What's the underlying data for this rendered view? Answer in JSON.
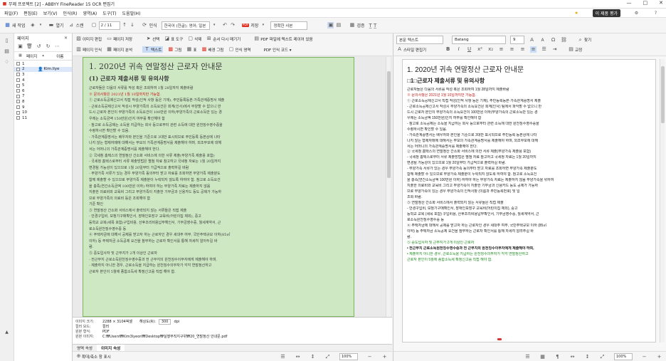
{
  "window": {
    "title": "무제 프로젝트 [2] - ABBYY FineReader 15 OCR 편집기",
    "min": "—",
    "max": "□",
    "close": "✕"
  },
  "menu": {
    "items": [
      "파일(F)",
      "편집(E)",
      "보기(V)",
      "인식(R)",
      "영역(A)",
      "도구(T)",
      "도움말(H)"
    ],
    "upgrade": "이 제품 평가"
  },
  "toolbar": {
    "new_task": "새 작업",
    "open": "열기",
    "scan": "스캔",
    "page_current": "2",
    "page_total": "/ 11",
    "recognize": "인식",
    "language": "한국어 (한글); 영어; 일본",
    "save": "저장",
    "pdf": "PDF",
    "save_format": "정확한 사본",
    "check": "검증",
    "ocr_icons": "T̲ T̲"
  },
  "pages_panel": {
    "title": "페이지",
    "col_page": "페이지",
    "col_name": "이름",
    "rows": [
      "1",
      "2",
      "3",
      "4",
      "5",
      "6",
      "7",
      "8",
      "9",
      "10",
      "11"
    ],
    "row2_name": "Kim.llye"
  },
  "image_panel": {
    "row1": [
      "이미지 편집",
      "페이지 저장",
      "선택",
      "표 도구",
      "삭제",
      "순서 다시 매기기",
      "PDF 파일에 텍스트 레이어 있음"
    ],
    "row2": [
      "페이지 인식",
      "페이지 분석",
      "텍스트",
      "그림",
      "표",
      "배경 그림",
      "인식 영역",
      "PDF 인식 코드 ▾"
    ],
    "scan_title": "1. 2020년 귀속 연말정산 근로자 안내문",
    "scan_subtitle": "(1) 근로자 제출서류 및 유의사항",
    "scan_lines": [
      "근로자들은 다음의 서류를 작성 혹은 조회하여 1월 28일까지 제출바람",
      "※ 문의사항은 2021년 1월 10일까지만 가능함.",
      "① 근로소득공제신고서 직접 작성(인적 사항 등은 기재), 주민등록등본·가족관계증명서 제출",
      "  - 근로소득공제신고서 작성시 부양가족의 소득요건은 회계(인사)에서 부양할 수 없으니 반",
      "  드시 근로자 본인이 부양가족의 소득요건이 100만원 이하(부양가족의 근로소득만 있는 경",
      "  우에는 소득금액 150만원)인지 여부를 확인해야 함",
      "  - 참고로 소득공제는 소득을 지급하는 회사 등으로부터 관련 소득에 대한 원천징수영수증을",
      "  수령하시면 확인할 수 있음.",
      "  - 가족관계증명서는 배우자와 본인을 기준으로 3대만 표시되므로 주민등록 등본상에 나타",
      "  나지 않는 형제자매에 대해서는 부모의 가족관계증명서를 제출해야 하며, 외조부모에 대해",
      "  서는 어머니의 가족관계증명서를 제출해야 한다.",
      "② 국세청 홈택스의 연말정산 간소화 서비스에 의한 서류 제출(부양가족 제출용 포함)",
      "  - 국세청 홈택스로부터 서류 제출방법은 별첨 자료 참고하고 국세청 자료는 1월 20일까지",
      "  변경될 가능성이 있으므로 1월 20일부터 가급적으로 출력하길 바람",
      "  - 부양가족 서류가 있는 경우 부양가족 동의부터 받고 자료를 조회하면 부양가족 제출분도",
      "  함께 제출할 수 있으므로 부양가족 제출분이 누락되지 않도록 하여야 함. 참고로 소득요건",
      "  을 충족(연간소득금액 100만원 이하) 하여야 하는 부양가족 자료는 제출하지 않음",
      "  지출한 의료비와 교육비 그리고 부양가족이 지출한 기부금과 신용카드 등도 공제가 가능하",
      "  므로 부양가족의 의료비 등은 조회해야 함",
      "  기준 확인",
      "③ 연말정산 간소화 서비스에서 출력되지 않는 서류들은 직접 제출",
      "  - 안경구입비, 보청기구매확인서, 장애인보장구 교육비(어린이집 제외), 중고",
      "  등학교 교복(세목 포함)구입비용, 산후조리비용납부확인서, 기부금영수증, 월세계약서, 근",
      "  로소득원천징수영수증 등",
      "④ 주택자금에 대해서 공제를 받고자 하는 근로자인 경우 세대주 여부, 국민주택규모 이하(85㎡",
      "  이하) 등 주택자금 소득공제 요건을 참부하는 근로자 확인서를 통해 자세히 알아두길 바",
      "  람.",
      "⑤ 중도입사자 및 근무지가 2개 이상인 근로자",
      "  - 전근무지 근로소득원천징수영수증과 전 근무지의 원천징수이무자에게 제출해야 하며,",
      "  - 제출하지 아니한 경우, 근로소득을 지급하는 원천징수의무자가 각각 연말정산하고",
      "  근로자 본인이 5월에 종합소득세 확정신고를 직접 해야 함."
    ]
  },
  "properties": {
    "image_size_label": "이미지 크기:",
    "image_size": "2288 × 3104픽셀",
    "resolution_label": "해상도(R):",
    "resolution": "300",
    "resolution_unit": "dpi",
    "color_label": "컬러 모드:",
    "color": "컬러",
    "format_label": "원본 형식:",
    "format": "PDF",
    "path_label": "원본 이미지:",
    "path": "C:₩Users₩Kim3lyeon₩Desktop₩실행부직지구위₩20_연말정산 안내문.pdf",
    "tab1": "영역 속성",
    "tab2": "이미지 속성"
  },
  "image_status": {
    "zoom_label": "확대/축소 창 표시",
    "zoom": "100%"
  },
  "text_panel": {
    "style": "본문 텍스트",
    "style_editor": "스타일 편집기",
    "font": "Batang",
    "size": "9",
    "find": "찾기",
    "correct": "교정",
    "title": "1. 2020년 귀속 연말정산 근로자 안내문",
    "subtitle": "□1□근로자 제출서류 및 유의사항",
    "lines": [
      "근로자들은 다음의 서류를 작성 혹은 조회하여 1월 28일까지 제출바람",
      "※ 문의사항은 2021년 1월 10일까지만 가능함.",
      "① 근로소득공제신고서 직접 작성(인적 사항 등은 기재), 주민등록등본·가족관계증명서 제출",
      "  - 근로소득공제신고서 작성시 부양가족의 소득요건은 회계(인사) 팀에서 파악할 수 없으니 반",
      "  드시 근로자 본인이 부양가족의 소득요건이 100만원 이하(부양가족의 근로소득만 있는 경",
      "  우에는 소득금액 150만원)인지 여부를 확인해야 함",
      "  - 참고로 소득공제는 소득을 지급하는 회사 등으로부터 관련 소득에 대한 원천징수영수증을",
      "  수령하시면 확인할 수 있음.",
      "  - 가족관계증명서는 배우자와 본인을 기준으로 3대만 표시되므로 주민등록 등본상에 나타",
      "  나지 않는 형제자매에 대해서는 부모의 가족관계증명서를 제출해야 하며, 외조부모에 대해",
      "  서는 어머니의 가족관계증명서를 제출해야 한다.",
      "② 국세청 홈택스의 연말정산 간소화 서비스에 의한 서류 제출(부양가족 제출용 포함)",
      "  - 국세청 홈택스로부터 서류 제출방법은 별첨 자료 참고하고 국세청 자료는 1월 20일까지",
      "  변경될 가능성이 있으므로 1월 20일부터 가급적으로 출력하길 바람.",
      "  - 부양가족 서류가 있는 경우 부양가족 동의부터 받고 자료를 조회하면 부양가족 제출분도",
      "  함께 제출할 수 있으므로 부양가족 제출분이 누락되지 않도록 하여야 함. 참고로 소득요건",
      "  을 충족(연간소득금액 100만원 이하) 하여야 하는 부양가족 자료는 제출하지 않음 부양가족을 위하여",
      "  지출한 의료비와 교육비 그리고 부양가족이 지출한 기부금과 신용카드 등도 공제가 가능하",
      "  므로 부양가족이 있는 경우 부양가족의 인적사항 (이름과 주민등록번호) 및 일",
      "  조회 바람.",
      "③ 연말정산 간소화 서비스에서 출력되지 않는 서류들은 직접 제출",
      "  - 안경구입비, 보청기구매확인서, 장애인보장구 교육비(어린이집 제외), 중고",
      "  등학교 교복 (세목 포함) 구입비용, 산후조리비용납부확인서, 기부금영수증, 월세계약서, 근",
      "  로소득원천징수영수증 등",
      "④ 주택자금에 대해서 공제를 받고자 하는 근로자인 경우 세대주 여부, 국민주택규모 이하 (85㎡",
      "  이하) 등 주택자금 소득공제 요건을 참부하는 근로자 확인서를 통해 자세히 알려주길 바",
      "  람.",
      "⑤ 중도입사자 및 근무지가 2개 이상인 근로자",
      "  • 전근무지 근로소득원천징수영수증과 전 근무지의 원천징수이무자에게 제출해야 하며,",
      "  • 제출하지 아니한 경우, 근로소득을 지급하는 원천징수의무자가 각각 연말정산하고",
      "  근로자 본인이 5월에 종합소득세 확정신고를 직접 해야 함."
    ]
  },
  "text_status": {
    "zoom": "100%"
  },
  "colors": {
    "accent": "#2a5fc4",
    "scan_highlight": "#cfe8c4",
    "red": "#c01818",
    "green": "#1f8a1f"
  }
}
